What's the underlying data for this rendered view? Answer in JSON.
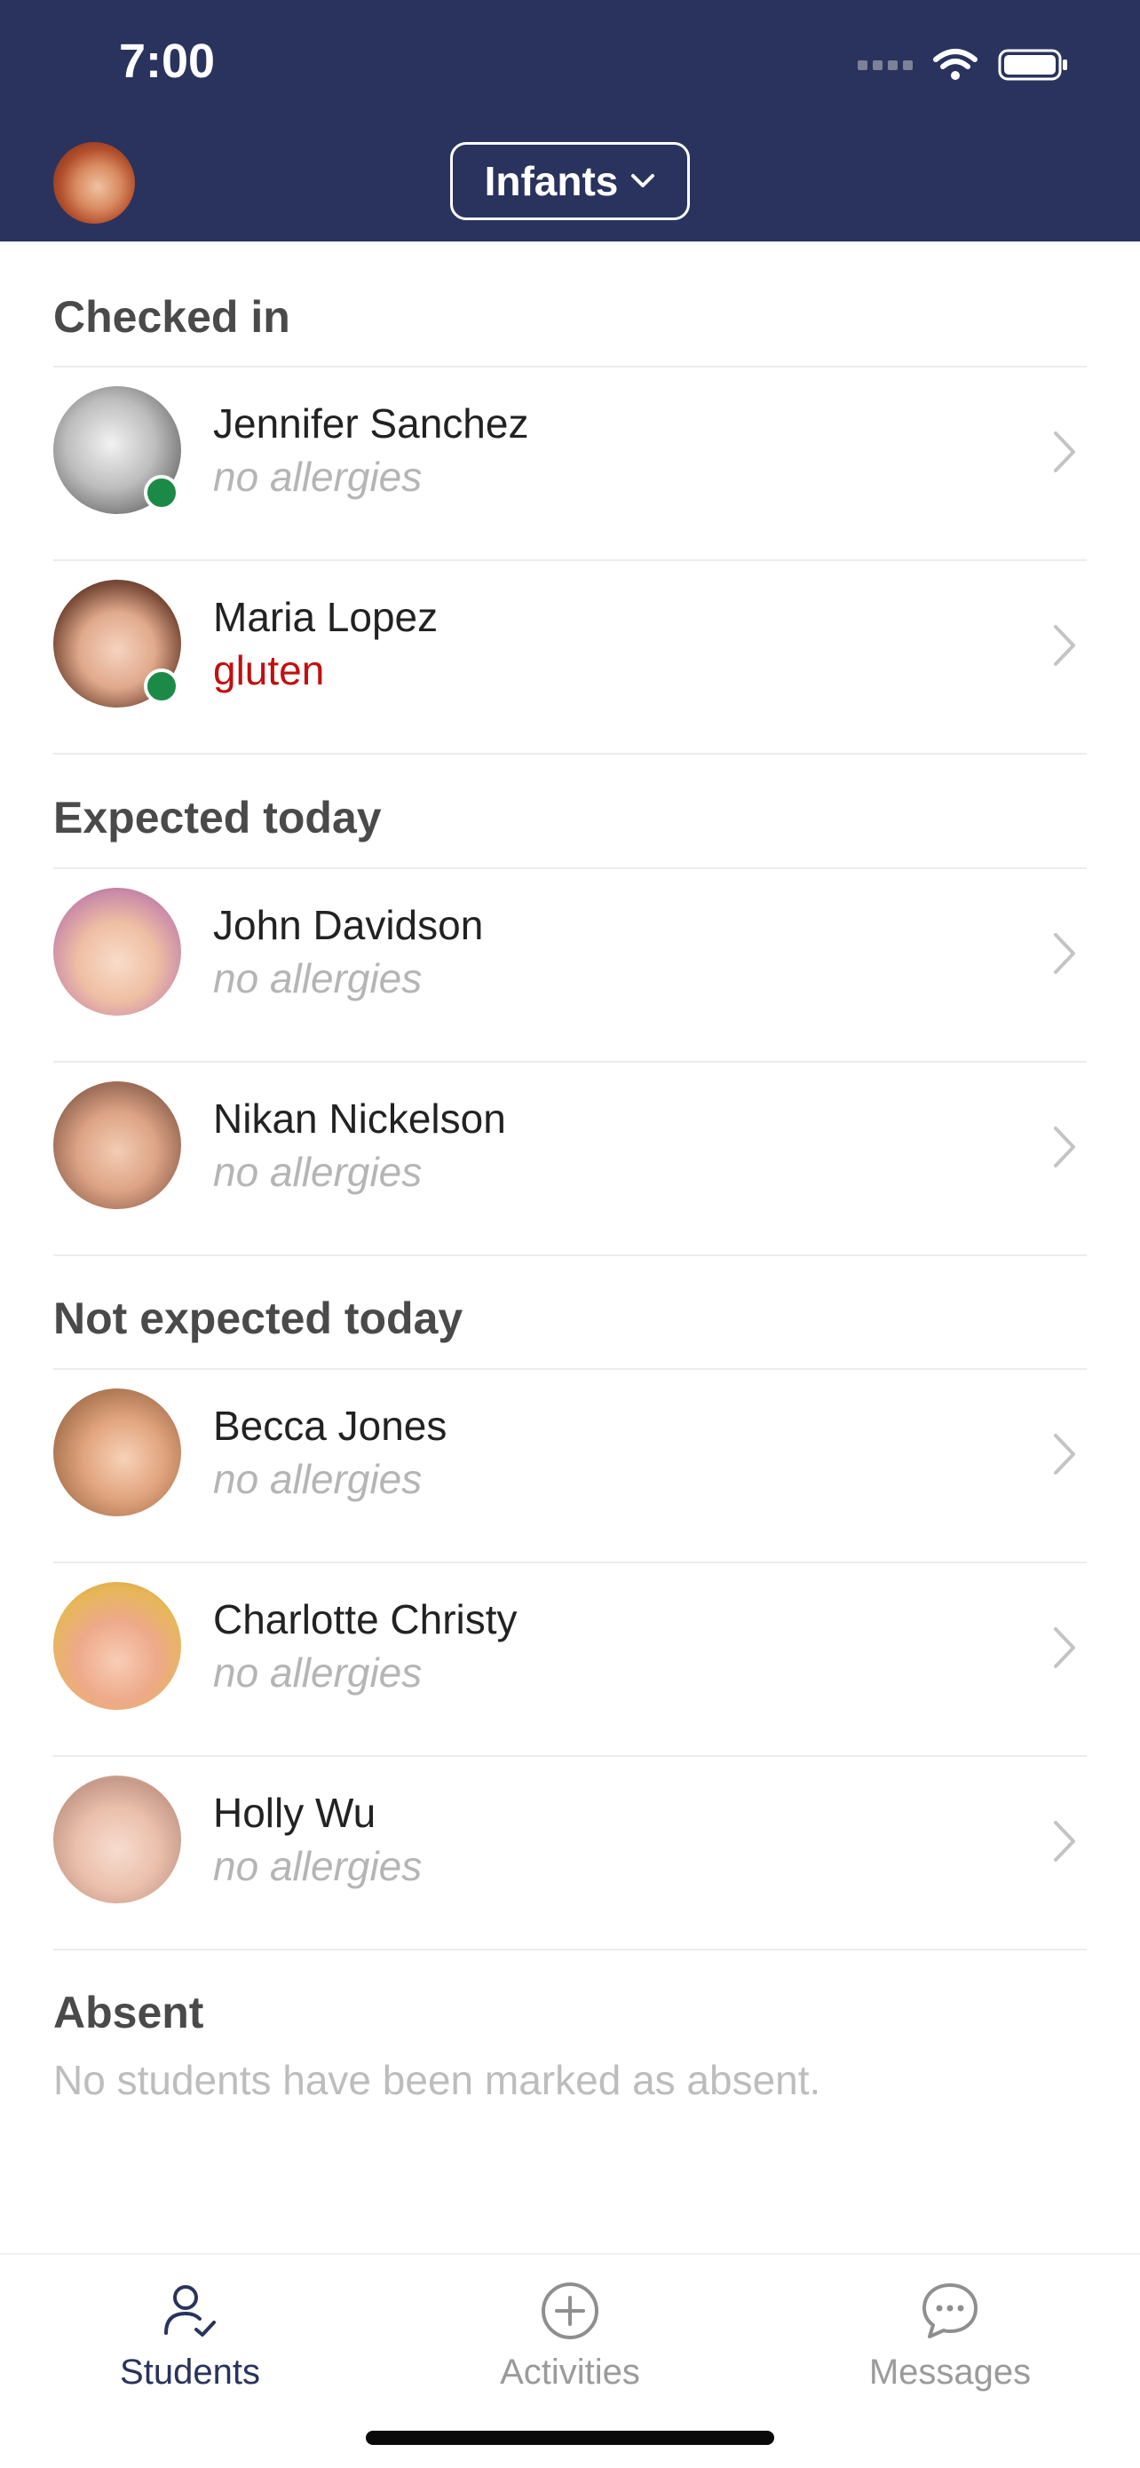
{
  "status_bar": {
    "time": "7:00"
  },
  "header": {
    "class_name": "Infants"
  },
  "sections": {
    "checked_in": {
      "title": "Checked in",
      "students": [
        {
          "name": "Jennifer Sanchez",
          "allergy": "no allergies"
        },
        {
          "name": "Maria Lopez",
          "allergy": "gluten"
        }
      ]
    },
    "expected_today": {
      "title": "Expected today",
      "students": [
        {
          "name": "John Davidson",
          "allergy": "no allergies"
        },
        {
          "name": "Nikan Nickelson",
          "allergy": "no allergies"
        }
      ]
    },
    "not_expected_today": {
      "title": "Not expected today",
      "students": [
        {
          "name": "Becca Jones",
          "allergy": "no allergies"
        },
        {
          "name": "Charlotte Christy",
          "allergy": "no allergies"
        },
        {
          "name": "Holly Wu",
          "allergy": "no allergies"
        }
      ]
    },
    "absent": {
      "title": "Absent",
      "empty_message": "No students have been marked as absent."
    }
  },
  "tabbar": {
    "students": "Students",
    "activities": "Activities",
    "messages": "Messages"
  },
  "colors": {
    "header_bg": "#2a335d",
    "online": "#1c8a47",
    "allergy_alert": "#c20f0f"
  }
}
